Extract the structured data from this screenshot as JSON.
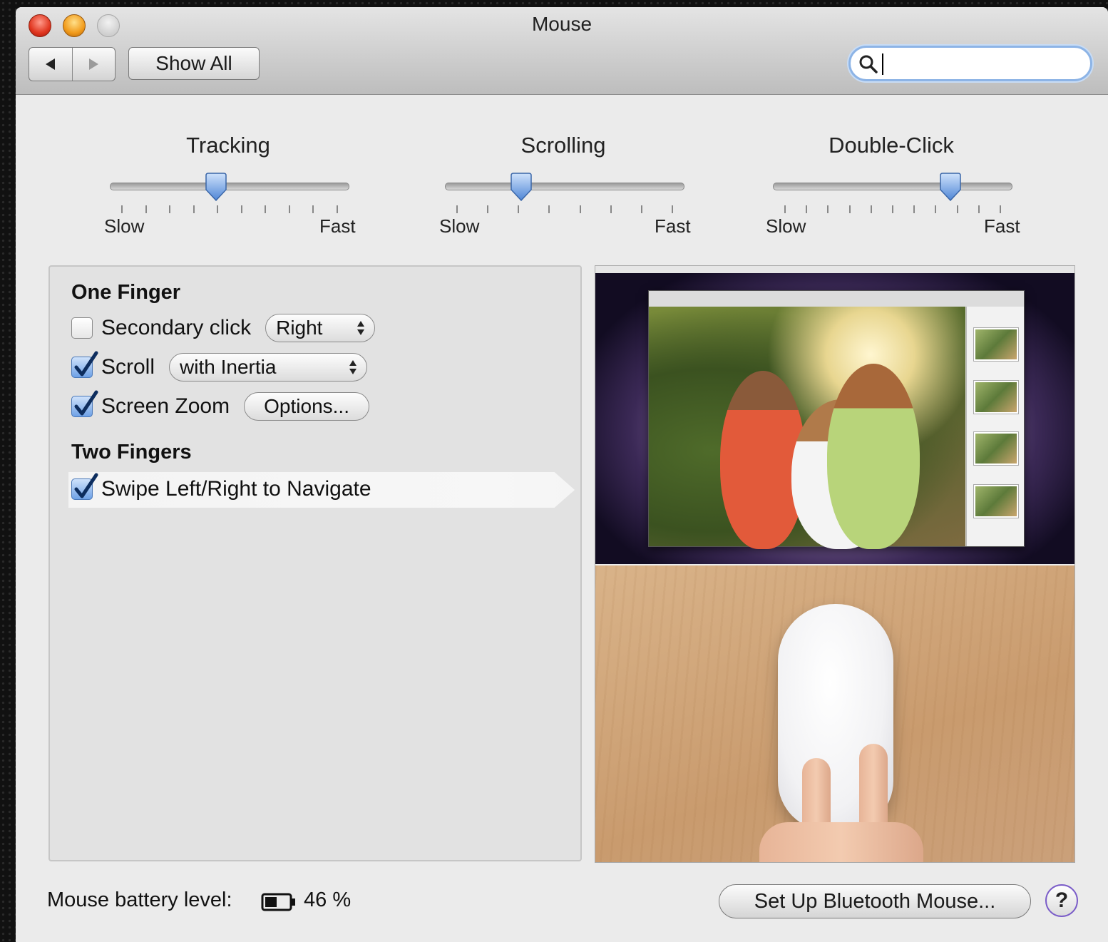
{
  "window": {
    "title": "Mouse"
  },
  "toolbar": {
    "back_icon": "back-arrow-icon",
    "forward_icon": "forward-arrow-icon",
    "show_all_label": "Show All",
    "search_placeholder": ""
  },
  "sliders": [
    {
      "label": "Tracking",
      "min_label": "Slow",
      "max_label": "Fast",
      "ticks": 10,
      "position": 0.44
    },
    {
      "label": "Scrolling",
      "min_label": "Slow",
      "max_label": "Fast",
      "ticks": 8,
      "position": 0.3
    },
    {
      "label": "Double-Click",
      "min_label": "Slow",
      "max_label": "Fast",
      "ticks": 11,
      "position": 0.77
    }
  ],
  "one_finger": {
    "title": "One Finger",
    "secondary_click": {
      "label": "Secondary click",
      "checked": false,
      "value": "Right"
    },
    "scroll": {
      "label": "Scroll",
      "checked": true,
      "value": "with Inertia"
    },
    "screen_zoom": {
      "label": "Screen Zoom",
      "checked": true,
      "options_label": "Options..."
    }
  },
  "two_fingers": {
    "title": "Two Fingers",
    "swipe": {
      "label": "Swipe Left/Right to Navigate",
      "checked": true
    }
  },
  "footer": {
    "battery_label": "Mouse battery level:",
    "battery_value": "46 %",
    "battery_level": 0.46,
    "setup_button": "Set Up Bluetooth Mouse...",
    "help_label": "?"
  },
  "colors": {
    "accent": "#6ea1e6",
    "help_ring": "#7a5cc8"
  }
}
